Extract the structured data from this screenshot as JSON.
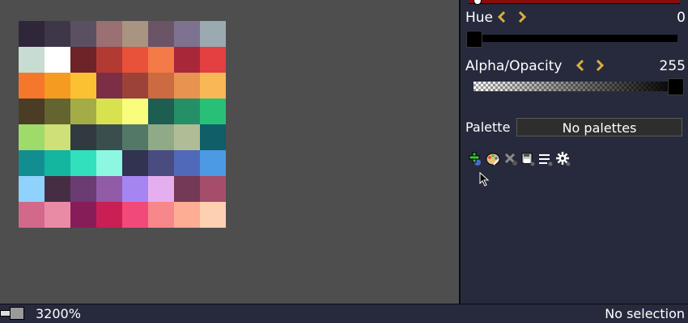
{
  "canvas": {
    "pixels": [
      "#30263a",
      "#3e3649",
      "#5b5062",
      "#9a7072",
      "#a89480",
      "#6a5466",
      "#7d7290",
      "#9aaab0",
      "#c7ddd2",
      "#ffffff",
      "#6e2328",
      "#b33a33",
      "#e8513a",
      "#f47a48",
      "#a8283a",
      "#e43f41",
      "#f5772b",
      "#f59b22",
      "#fbc133",
      "#7c2e46",
      "#9c4238",
      "#cc6a42",
      "#e8934f",
      "#f9b856",
      "#4b3c26",
      "#646430",
      "#a4ac48",
      "#d8e24e",
      "#f9fc7c",
      "#1e5d51",
      "#259068",
      "#27c076",
      "#9fdb6b",
      "#cfe076",
      "#303a40",
      "#3a4e4e",
      "#537868",
      "#90aa88",
      "#b0bc96",
      "#0f5e68",
      "#128e90",
      "#15b6a0",
      "#33e0be",
      "#8cf8e2",
      "#323251",
      "#4a4c80",
      "#5169b9",
      "#4d9ae4",
      "#8fd2fb",
      "#452e44",
      "#6a3c72",
      "#915ba8",
      "#a585f2",
      "#e5aeee",
      "#743a55",
      "#a64d6c",
      "#d2698a",
      "#ea8ba5",
      "#861d59",
      "#c91f54",
      "#f24a78",
      "#f7878a",
      "#fdad94",
      "#fed0b2"
    ]
  },
  "panel": {
    "hue_label": "Hue",
    "hue_value": "0",
    "hue_level": 0,
    "alpha_label": "Alpha/Opacity",
    "alpha_value": "255",
    "alpha_level": 1,
    "palette_label": "Palette",
    "palette_selected": "No palettes",
    "tools": [
      "add-palette-icon",
      "edit-palette-icon",
      "delete-palette-icon",
      "save-palette-icon",
      "palette-menu-icon",
      "palette-settings-icon"
    ]
  },
  "status": {
    "zoom": "3200%",
    "selection": "No selection"
  },
  "colors": {
    "accent_chevron": "#d8b040",
    "panel_bg": "#272a3d",
    "canvas_bg": "#4e4e4e"
  }
}
